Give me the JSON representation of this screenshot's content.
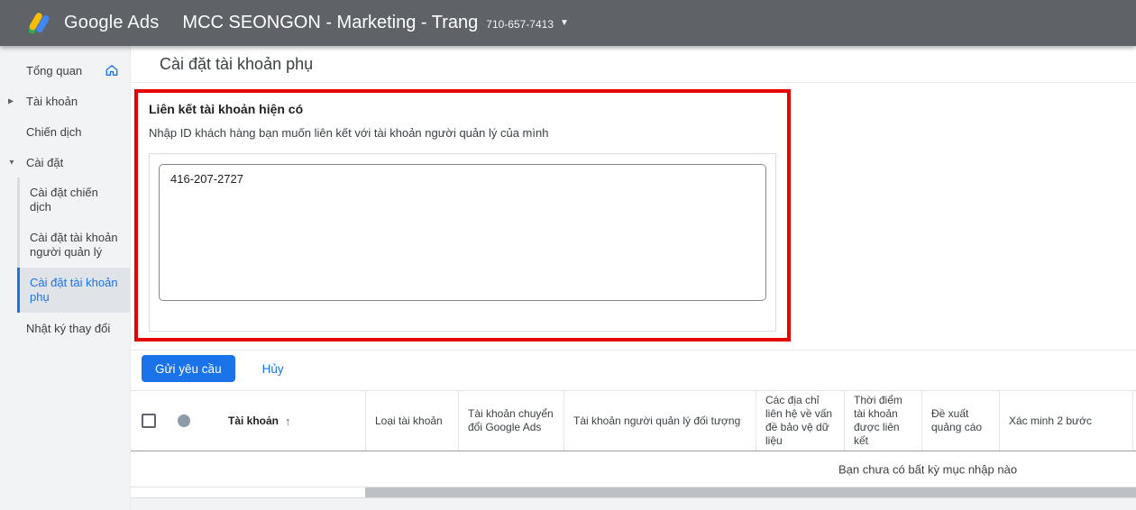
{
  "topbar": {
    "brand": "Google Ads",
    "account_name": "MCC SEONGON - Marketing - Trang",
    "account_id": "710-657-7413",
    "dropdown_caret": "▼"
  },
  "icons": {
    "caret_right": "▶",
    "caret_down": "▼",
    "sort_up": "↑"
  },
  "sidebar": {
    "overview": "Tổng quan",
    "accounts": "Tài khoản",
    "campaigns": "Chiến dịch",
    "settings": "Cài đặt",
    "settings_sub": {
      "campaign_settings": "Cài đặt chiến dịch",
      "manager_account_settings": "Cài đặt tài khoản người quản lý",
      "sub_account_settings": "Cài đặt tài khoản phụ"
    },
    "change_log": "Nhật ký thay đổi"
  },
  "page": {
    "title": "Cài đặt tài khoản phụ"
  },
  "link_form": {
    "heading": "Liên kết tài khoản hiện có",
    "instruction": "Nhập ID khách hàng bạn muốn liên kết với tài khoản người quản lý của mình",
    "customer_id_value": "416-207-2727",
    "submit_label": "Gửi yêu cầu",
    "cancel_label": "Hủy"
  },
  "table": {
    "columns": [
      "Tài khoản",
      "Loại tài khoản",
      "Tài khoản chuyển đổi Google Ads",
      "Tài khoản người quản lý đối tượng",
      "Các địa chỉ liên hệ về vấn đề bảo vệ dữ liệu",
      "Thời điểm tài khoản được liên kết",
      "Đề xuất quảng cáo",
      "Xác minh 2 bước"
    ],
    "empty_message": "Bạn chưa có bất kỳ mục nhập nào"
  },
  "colors": {
    "accent": "#1a73e8",
    "topbar": "#5f6368",
    "highlight_border": "#e60000",
    "selected_nav_bg": "#e0e4e9"
  }
}
